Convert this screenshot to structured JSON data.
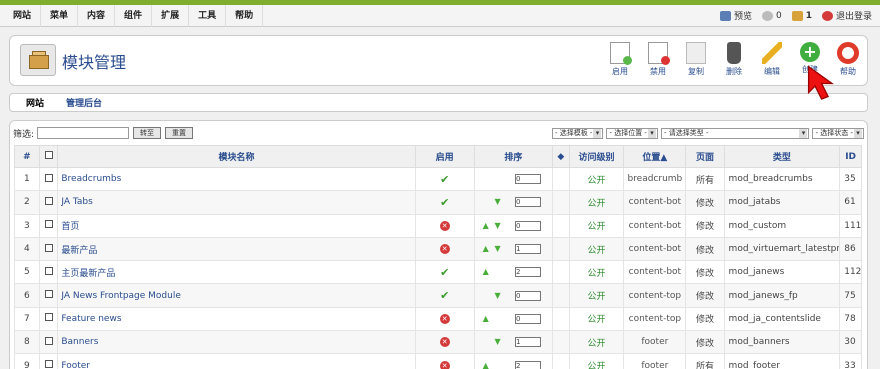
{
  "menu": [
    "网站",
    "菜单",
    "内容",
    "组件",
    "扩展",
    "工具",
    "帮助"
  ],
  "menu_right": {
    "preview": "预览",
    "messages_count": "0",
    "users_count": "1",
    "logout": "退出登录"
  },
  "header": {
    "title": "模块管理"
  },
  "toolbar": {
    "enable": "启用",
    "disable": "禁用",
    "copy": "复制",
    "delete": "删除",
    "edit": "编辑",
    "new": "创建",
    "help": "帮助"
  },
  "tabs": [
    "网站",
    "管理后台"
  ],
  "filter": {
    "label": "筛选:",
    "go": "转至",
    "reset": "重置",
    "selects": [
      "- 选择模板 -",
      "- 选择位置 -",
      "- 请选择类型 -",
      "- 选择状态 -"
    ]
  },
  "columns": [
    "#",
    "",
    "模块名称",
    "启用",
    "排序",
    "",
    "访问级别",
    "位置▲",
    "页面",
    "类型",
    "ID"
  ],
  "rows": [
    {
      "num": "1",
      "name": "Breadcrumbs",
      "enabled": true,
      "up": false,
      "down": false,
      "order": "0",
      "access": "公开",
      "position": "breadcrumb",
      "pages": "所有",
      "type": "mod_breadcrumbs",
      "id": "35"
    },
    {
      "num": "2",
      "name": "JA Tabs",
      "enabled": true,
      "up": false,
      "down": true,
      "order": "0",
      "access": "公开",
      "position": "content-bot",
      "pages": "修改",
      "type": "mod_jatabs",
      "id": "61"
    },
    {
      "num": "3",
      "name": "首页",
      "enabled": false,
      "up": true,
      "down": true,
      "order": "0",
      "access": "公开",
      "position": "content-bot",
      "pages": "修改",
      "type": "mod_custom",
      "id": "111"
    },
    {
      "num": "4",
      "name": "最新产品",
      "enabled": false,
      "up": true,
      "down": true,
      "order": "1",
      "access": "公开",
      "position": "content-bot",
      "pages": "修改",
      "type": "mod_virtuemart_latestprod",
      "id": "86"
    },
    {
      "num": "5",
      "name": "主页最新产品",
      "enabled": true,
      "up": true,
      "down": false,
      "order": "2",
      "access": "公开",
      "position": "content-bot",
      "pages": "修改",
      "type": "mod_janews",
      "id": "112"
    },
    {
      "num": "6",
      "name": "JA News Frontpage Module",
      "enabled": true,
      "up": false,
      "down": true,
      "order": "0",
      "access": "公开",
      "position": "content-top",
      "pages": "修改",
      "type": "mod_janews_fp",
      "id": "75"
    },
    {
      "num": "7",
      "name": "Feature news",
      "enabled": false,
      "up": true,
      "down": false,
      "order": "0",
      "access": "公开",
      "position": "content-top",
      "pages": "修改",
      "type": "mod_ja_contentslide",
      "id": "78"
    },
    {
      "num": "8",
      "name": "Banners",
      "enabled": false,
      "up": false,
      "down": true,
      "order": "1",
      "access": "公开",
      "position": "footer",
      "pages": "修改",
      "type": "mod_banners",
      "id": "30"
    },
    {
      "num": "9",
      "name": "Footer",
      "enabled": false,
      "up": true,
      "down": false,
      "order": "2",
      "access": "公开",
      "position": "footer",
      "pages": "所有",
      "type": "mod_footer",
      "id": "33"
    }
  ]
}
